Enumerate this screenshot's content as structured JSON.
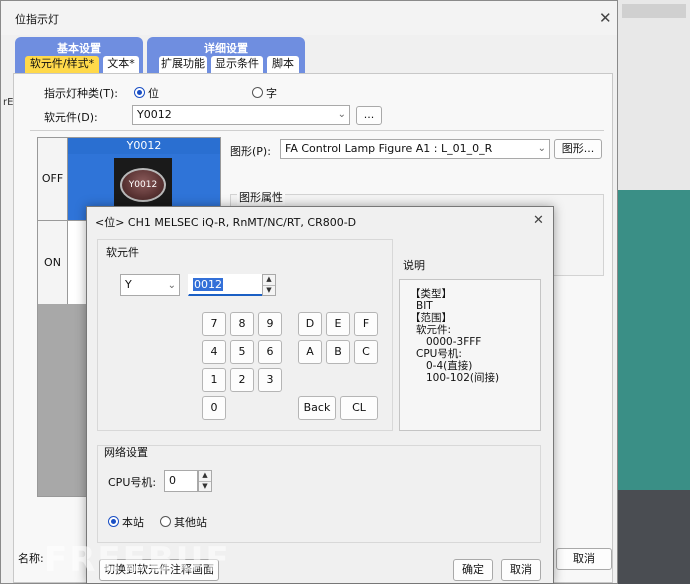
{
  "back_window": {
    "title": "位指示灯",
    "tab_groups": [
      {
        "title": "基本设置",
        "subtabs": [
          "软元件/样式*",
          "文本*"
        ]
      },
      {
        "title": "详细设置",
        "subtabs": [
          "扩展功能",
          "显示条件",
          "脚本"
        ]
      }
    ],
    "indicator_type_label": "指示灯种类(T):",
    "indicator_type_options": [
      "位",
      "字"
    ],
    "device_label": "软元件(D):",
    "device_value": "Y0012",
    "browse_label": "...",
    "states": {
      "off_label": "OFF",
      "on_label": "ON",
      "off_header": "Y0012",
      "lamp_text": "Y0012"
    },
    "figure_label": "图形(P):",
    "figure_value": "FA Control Lamp Figure A1 : L_01_0_R",
    "figure_button": "图形...",
    "figure_props_label": "图形属性",
    "name_label": "名称:",
    "cancel_label": "取消",
    "left_edge_label": "rE"
  },
  "dialog": {
    "title": "<位> CH1 MELSEC iQ-R, RnMT/NC/RT, CR800-D",
    "device_section_label": "软元件",
    "device_type": "Y",
    "device_number": "0012",
    "keypad_rows": [
      [
        "7",
        "8",
        "9",
        "D",
        "E",
        "F"
      ],
      [
        "4",
        "5",
        "6",
        "A",
        "B",
        "C"
      ],
      [
        "1",
        "2",
        "3"
      ],
      [
        "0"
      ]
    ],
    "back_key": "Back",
    "clear_key": "CL",
    "description_label": "说明",
    "description_lines": [
      "【类型】",
      "BIT",
      "【范围】",
      "软元件:",
      "0000-3FFF",
      "CPU号机:",
      "0-4(直接)",
      "100-102(间接)"
    ],
    "network_label": "网络设置",
    "cpu_label": "CPU号机:",
    "cpu_value": "0",
    "station_options": [
      "本站",
      "其他站"
    ],
    "switch_button": "切换到软元件注释画面",
    "ok_button": "确定",
    "cancel_button": "取消"
  },
  "watermark": "FREEBUF",
  "colors": {
    "tab_blue": "#6f8ee0",
    "active_tab": "#ffd94a",
    "off_blue": "#2f74d8",
    "desktop_teal": "#3a8f86"
  }
}
